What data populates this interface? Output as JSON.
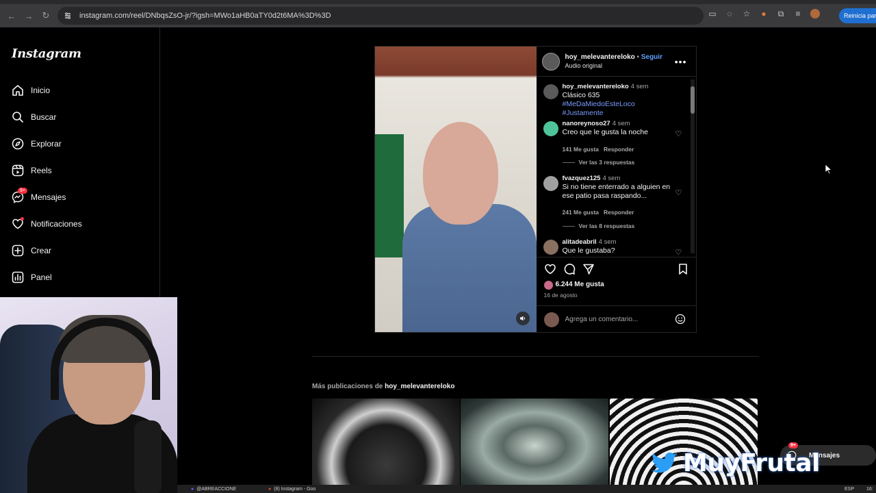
{
  "browser": {
    "url": "instagram.com/reel/DNbqsZsO-jr/?igsh=MWo1aHB0aTY0d2t6MA%3D%3D",
    "restart_button": "Reinicia para"
  },
  "sidebar": {
    "logo": "Instagram",
    "items": [
      {
        "label": "Inicio",
        "icon": "home-icon"
      },
      {
        "label": "Buscar",
        "icon": "search-icon"
      },
      {
        "label": "Explorar",
        "icon": "compass-icon"
      },
      {
        "label": "Reels",
        "icon": "reels-icon"
      },
      {
        "label": "Mensajes",
        "icon": "messenger-icon",
        "badge": "9+"
      },
      {
        "label": "Notificaciones",
        "icon": "heart-icon"
      },
      {
        "label": "Crear",
        "icon": "plus-square-icon"
      },
      {
        "label": "Panel",
        "icon": "chart-icon"
      }
    ]
  },
  "post": {
    "username": "hoy_melevantereloko",
    "separator": "•",
    "follow": "Seguir",
    "audio": "Audio original",
    "caption": {
      "username": "hoy_melevantereloko",
      "time": "4 sem",
      "text": "Clásico 635",
      "tag1": "#MeDaMiedoEsteLoco",
      "tag2": "#Justamente"
    },
    "comments": [
      {
        "username": "nanoreynoso27",
        "time": "4 sem",
        "text": "Creo que le gusta la noche",
        "likes": "141 Me gusta",
        "reply": "Responder",
        "view_replies": "Ver las 3 respuestas"
      },
      {
        "username": "fvazquez125",
        "time": "4 sem",
        "text": "Si no tiene enterrado a alguien en ese patio pasa raspando...",
        "likes": "241 Me gusta",
        "reply": "Responder",
        "view_replies": "Ver las 8 respuestas"
      },
      {
        "username": "alitadeabril",
        "time": "4 sem",
        "text": "Que le gustaba?"
      }
    ],
    "like_count": "6.244 Me gusta",
    "date": "16 de agosto",
    "comment_placeholder": "Agrega un comentario..."
  },
  "more_posts": {
    "prefix": "Más publicaciones de",
    "username": "hoy_melevantereloko"
  },
  "overlay": {
    "messages_pill": "Mensajes",
    "messages_badge": "9+",
    "watermark": "MuyFrutal"
  },
  "taskbar": {
    "item1": "@ABREACCIONE",
    "item2": "(8) Instagram - Goo",
    "lang": "ESP",
    "clock": "16:"
  },
  "colors": {
    "accent_link": "#5aa2ff",
    "notification": "#ff3040",
    "hashtag": "#7a9cff"
  }
}
